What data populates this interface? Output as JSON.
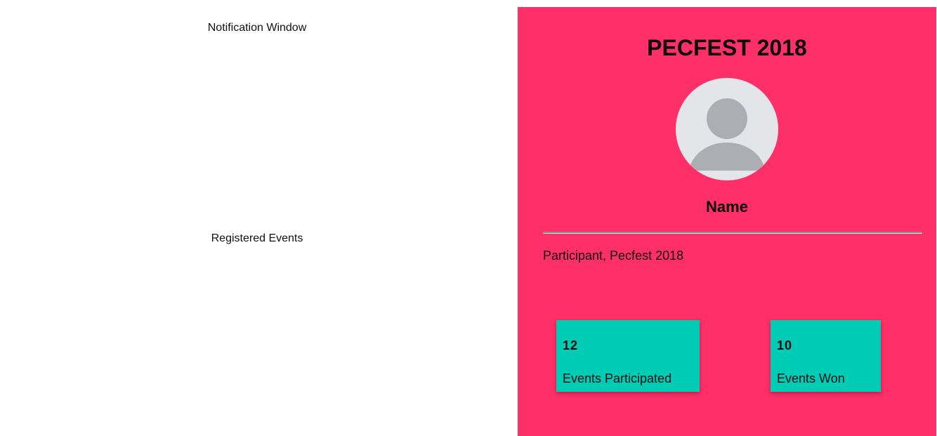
{
  "notifications": {
    "title": "Notification Window"
  },
  "registered_events": {
    "title": "Registered Events"
  },
  "profile": {
    "brand": "PECFEST 2018",
    "avatar_icon": "user-avatar-icon",
    "name": "Name",
    "role": "Participant, Pecfest 2018",
    "background_color": "#ff2f68",
    "stats": [
      {
        "value": "12",
        "label": "Events Participated"
      },
      {
        "value": "10",
        "label": "Events Won"
      }
    ],
    "stat_card_color": "#00cbb5"
  }
}
